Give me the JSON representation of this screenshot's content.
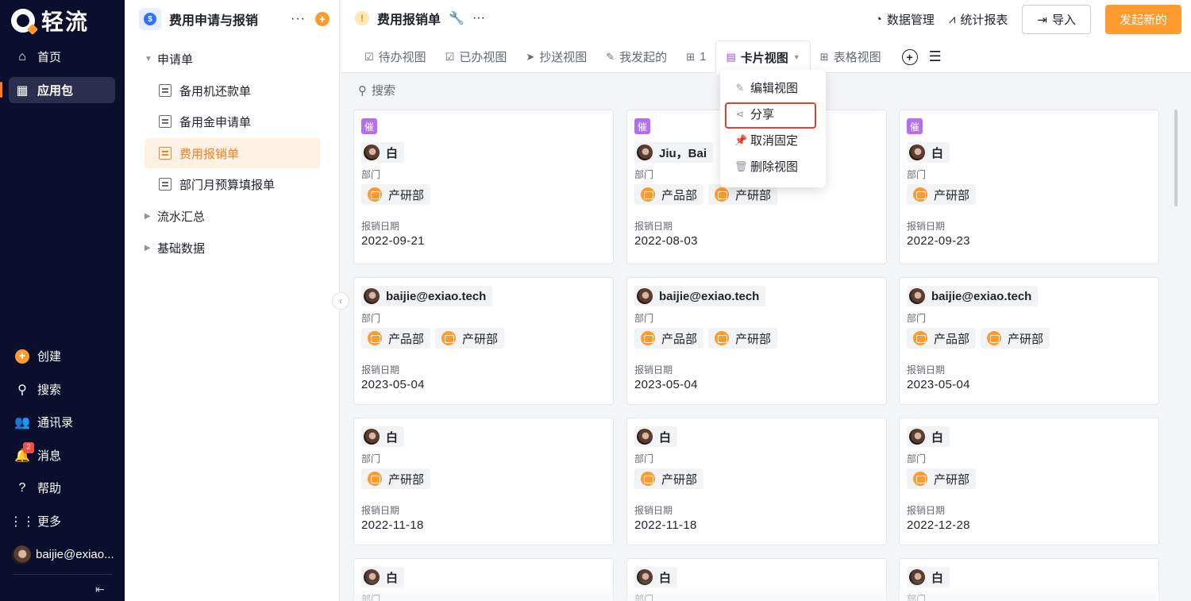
{
  "nav": {
    "logo_text": "轻流",
    "items": [
      {
        "label": "首页",
        "icon": "home-icon"
      },
      {
        "label": "应用包",
        "icon": "apps-icon"
      }
    ],
    "bottom": [
      {
        "label": "创建",
        "icon": "plus-icon"
      },
      {
        "label": "搜索",
        "icon": "search-icon"
      },
      {
        "label": "通讯录",
        "icon": "contacts-icon"
      },
      {
        "label": "消息",
        "icon": "bell-icon",
        "badge": "2"
      },
      {
        "label": "帮助",
        "icon": "help-icon"
      },
      {
        "label": "更多",
        "icon": "grid-icon"
      }
    ],
    "user": "baijie@exiao...",
    "colors": {
      "bg": "#0b0f2e",
      "accent": "#ff7d1f"
    }
  },
  "tree": {
    "title": "费用申请与报销",
    "groups": [
      {
        "label": "申请单",
        "expanded": true
      },
      {
        "label": "流水汇总",
        "expanded": false
      },
      {
        "label": "基础数据",
        "expanded": false
      }
    ],
    "forms": [
      "备用机还款单",
      "备用金申请单",
      "费用报销单",
      "部门月预算填报单"
    ]
  },
  "header": {
    "title": "费用报销单",
    "actions": [
      "数据管理",
      "统计报表"
    ],
    "import_label": "导入",
    "new_label": "发起新的"
  },
  "tabs": [
    "待办视图",
    "已办视图",
    "抄送视图",
    "我发起的",
    "1",
    "卡片视图",
    "表格视图"
  ],
  "popover": [
    "编辑视图",
    "分享",
    "取消固定",
    "删除视图"
  ],
  "search": {
    "label": "搜索"
  },
  "fields": {
    "dept": "部门",
    "date": "报销日期",
    "urge": "催"
  },
  "cards": [
    {
      "urge": true,
      "user": "白",
      "depts": [
        "产研部"
      ],
      "date": "2022-09-21"
    },
    {
      "urge": true,
      "user": "Jiu，Bai",
      "depts": [
        "产品部",
        "产研部"
      ],
      "date": "2022-08-03"
    },
    {
      "urge": true,
      "user": "白",
      "depts": [
        "产研部"
      ],
      "date": "2022-09-23"
    },
    {
      "urge": false,
      "user": "baijie@exiao.tech",
      "depts": [
        "产品部",
        "产研部"
      ],
      "date": "2023-05-04"
    },
    {
      "urge": false,
      "user": "baijie@exiao.tech",
      "depts": [
        "产品部",
        "产研部"
      ],
      "date": "2023-05-04"
    },
    {
      "urge": false,
      "user": "baijie@exiao.tech",
      "depts": [
        "产品部",
        "产研部"
      ],
      "date": "2023-05-04"
    },
    {
      "urge": false,
      "user": "白",
      "depts": [
        "产研部"
      ],
      "date": "2022-11-18"
    },
    {
      "urge": false,
      "user": "白",
      "depts": [
        "产研部"
      ],
      "date": "2022-11-18"
    },
    {
      "urge": false,
      "user": "白",
      "depts": [
        "产研部"
      ],
      "date": "2022-12-28"
    },
    {
      "urge": false,
      "user": "白",
      "depts": [],
      "date": ""
    },
    {
      "urge": false,
      "user": "白",
      "depts": [],
      "date": ""
    },
    {
      "urge": false,
      "user": "白",
      "depts": [],
      "date": ""
    }
  ]
}
